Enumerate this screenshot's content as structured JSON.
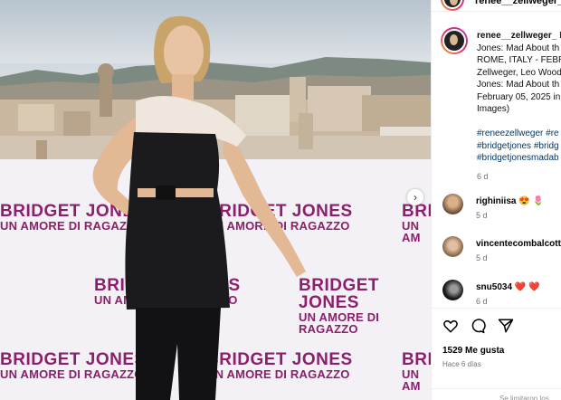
{
  "post": {
    "username": "renee__zellweger_",
    "caption_lines": [
      "Br",
      "Jones: Mad About th",
      "ROME, ITALY - FEBRU",
      "Zellweger, Leo Wood",
      "Jones: Mad About th",
      "February 05, 2025 in",
      "Images)"
    ],
    "hashtags": [
      "#reneezellweger #re",
      "#bridgetjones #bridg",
      "#bridgetjonesmadab"
    ],
    "caption_time": "6 d"
  },
  "banner": {
    "title": "BRIDGET JONES",
    "subtitle": "UN AMORE DI RAGAZZO",
    "title_partial": "BRI",
    "subtitle_partial": "UN AM"
  },
  "comments": [
    {
      "user": "righiniisa",
      "emoji": "😍 🌷",
      "time": "5 d"
    },
    {
      "user": "vincentecombalcotte",
      "emoji": "",
      "time": "5 d"
    },
    {
      "user": "snu5034",
      "emoji": "❤️ ❤️",
      "time": "6 d"
    }
  ],
  "actions": {
    "likes": "1529 Me gusta",
    "posted": "Hace 6 días",
    "icons": [
      "heart-icon",
      "comment-icon",
      "share-icon"
    ],
    "login_hint": "Se limitaron los"
  },
  "colors": {
    "brand": "#8c1f6d",
    "link": "#00376b",
    "meta": "#737373"
  }
}
